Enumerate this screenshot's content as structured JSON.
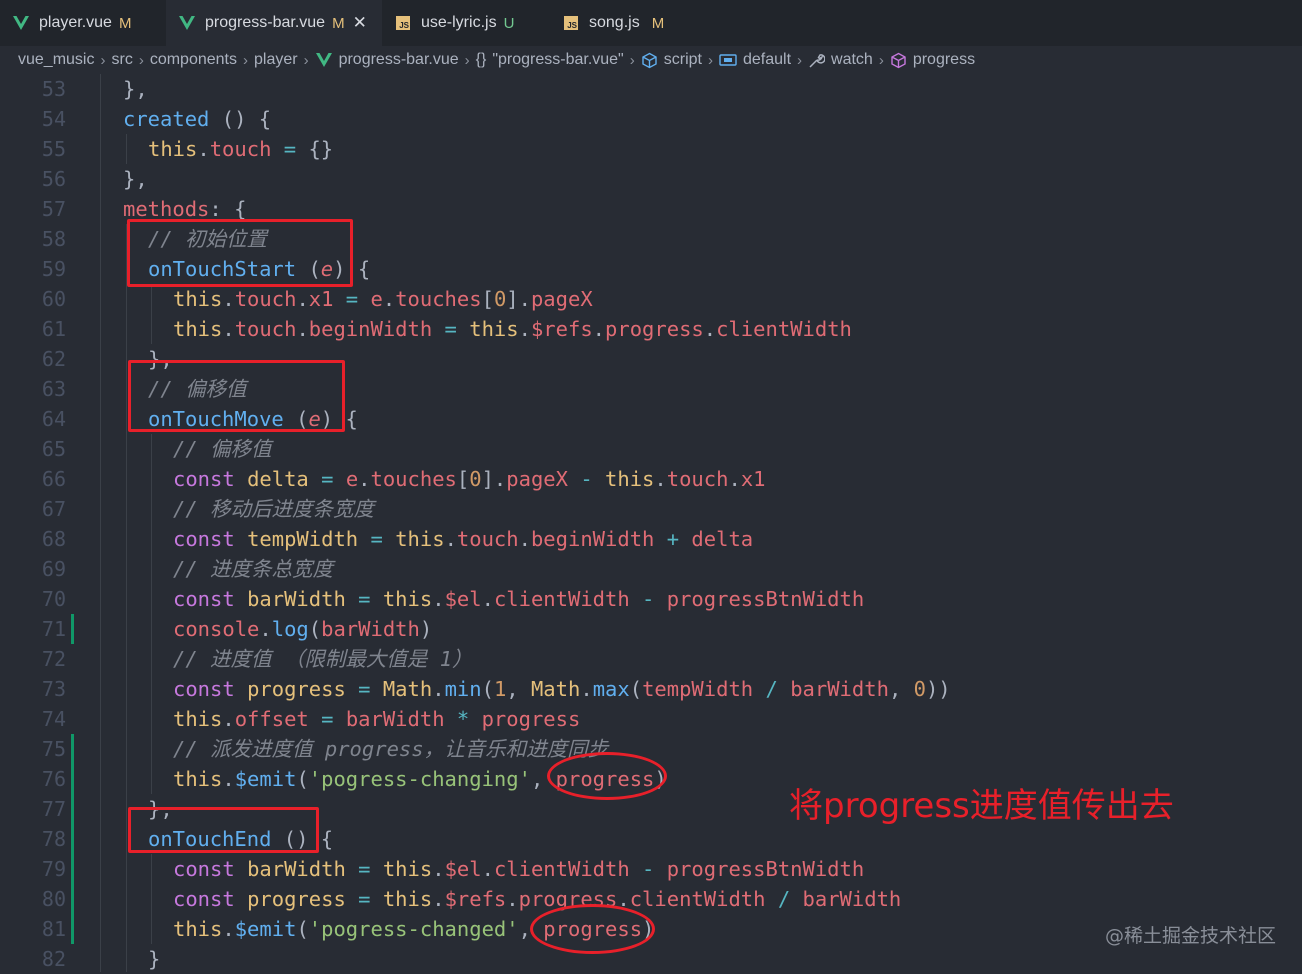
{
  "tabs": [
    {
      "label": "player.vue",
      "badge": "M",
      "icon": "vue-icon",
      "active": false
    },
    {
      "label": "progress-bar.vue",
      "badge": "M",
      "icon": "vue-icon",
      "active": true,
      "close": "✕"
    },
    {
      "label": "use-lyric.js",
      "badge": "U",
      "icon": "js-icon",
      "active": false
    },
    {
      "label": "song.js",
      "badge": "M",
      "icon": "js-icon",
      "active": false
    }
  ],
  "breadcrumb": [
    "vue_music",
    "src",
    "components",
    "player",
    "progress-bar.vue",
    "\"progress-bar.vue\"",
    "script",
    "default",
    "watch",
    "progress"
  ],
  "lines": [
    {
      "n": "53",
      "indent": 0,
      "t": [
        [
          "p",
          "},"
        ]
      ]
    },
    {
      "n": "54",
      "indent": 0,
      "t": [
        [
          "fn",
          "created"
        ],
        [
          "p",
          " () {"
        ]
      ]
    },
    {
      "n": "55",
      "indent": 1,
      "t": [
        [
          "thisk",
          "this"
        ],
        [
          "p",
          "."
        ],
        [
          "prop",
          "touch"
        ],
        [
          "op",
          " = "
        ],
        [
          "p",
          "{}"
        ]
      ]
    },
    {
      "n": "56",
      "indent": 0,
      "t": [
        [
          "p",
          "},"
        ]
      ]
    },
    {
      "n": "57",
      "indent": 0,
      "t": [
        [
          "prop",
          "methods"
        ],
        [
          "p",
          ": {"
        ]
      ]
    },
    {
      "n": "58",
      "indent": 1,
      "t": [
        [
          "cm",
          "// 初始位置"
        ]
      ]
    },
    {
      "n": "59",
      "indent": 1,
      "t": [
        [
          "fn",
          "onTouchStart"
        ],
        [
          "p",
          " ("
        ],
        [
          "param",
          "e"
        ],
        [
          "p",
          ") {"
        ]
      ]
    },
    {
      "n": "60",
      "indent": 2,
      "t": [
        [
          "thisk",
          "this"
        ],
        [
          "p",
          "."
        ],
        [
          "prop",
          "touch"
        ],
        [
          "p",
          "."
        ],
        [
          "prop",
          "x1"
        ],
        [
          "op",
          " = "
        ],
        [
          "varb",
          "e"
        ],
        [
          "p",
          "."
        ],
        [
          "prop",
          "touches"
        ],
        [
          "p",
          "["
        ],
        [
          "num",
          "0"
        ],
        [
          "p",
          "]."
        ],
        [
          "prop",
          "pageX"
        ]
      ]
    },
    {
      "n": "61",
      "indent": 2,
      "t": [
        [
          "thisk",
          "this"
        ],
        [
          "p",
          "."
        ],
        [
          "prop",
          "touch"
        ],
        [
          "p",
          "."
        ],
        [
          "prop",
          "beginWidth"
        ],
        [
          "op",
          " = "
        ],
        [
          "thisk",
          "this"
        ],
        [
          "p",
          "."
        ],
        [
          "prop",
          "$refs"
        ],
        [
          "p",
          "."
        ],
        [
          "prop",
          "progress"
        ],
        [
          "p",
          "."
        ],
        [
          "prop",
          "clientWidth"
        ]
      ]
    },
    {
      "n": "62",
      "indent": 1,
      "t": [
        [
          "p",
          "},"
        ]
      ]
    },
    {
      "n": "63",
      "indent": 1,
      "t": [
        [
          "cm",
          "// 偏移值"
        ]
      ]
    },
    {
      "n": "64",
      "indent": 1,
      "t": [
        [
          "fn",
          "onTouchMove"
        ],
        [
          "p",
          " ("
        ],
        [
          "param",
          "e"
        ],
        [
          "p",
          ") {"
        ]
      ]
    },
    {
      "n": "65",
      "indent": 2,
      "t": [
        [
          "cm",
          "// 偏移值"
        ]
      ]
    },
    {
      "n": "66",
      "indent": 2,
      "t": [
        [
          "kw",
          "const"
        ],
        [
          "p",
          " "
        ],
        [
          "cls",
          "delta"
        ],
        [
          "op",
          " = "
        ],
        [
          "varb",
          "e"
        ],
        [
          "p",
          "."
        ],
        [
          "prop",
          "touches"
        ],
        [
          "p",
          "["
        ],
        [
          "num",
          "0"
        ],
        [
          "p",
          "]."
        ],
        [
          "prop",
          "pageX"
        ],
        [
          "op",
          " - "
        ],
        [
          "thisk",
          "this"
        ],
        [
          "p",
          "."
        ],
        [
          "prop",
          "touch"
        ],
        [
          "p",
          "."
        ],
        [
          "prop",
          "x1"
        ]
      ]
    },
    {
      "n": "67",
      "indent": 2,
      "t": [
        [
          "cm",
          "// 移动后进度条宽度"
        ]
      ]
    },
    {
      "n": "68",
      "indent": 2,
      "t": [
        [
          "kw",
          "const"
        ],
        [
          "p",
          " "
        ],
        [
          "cls",
          "tempWidth"
        ],
        [
          "op",
          " = "
        ],
        [
          "thisk",
          "this"
        ],
        [
          "p",
          "."
        ],
        [
          "prop",
          "touch"
        ],
        [
          "p",
          "."
        ],
        [
          "prop",
          "beginWidth"
        ],
        [
          "op",
          " + "
        ],
        [
          "varb",
          "delta"
        ]
      ]
    },
    {
      "n": "69",
      "indent": 2,
      "t": [
        [
          "cm",
          "// 进度条总宽度"
        ]
      ]
    },
    {
      "n": "70",
      "indent": 2,
      "t": [
        [
          "kw",
          "const"
        ],
        [
          "p",
          " "
        ],
        [
          "cls",
          "barWidth"
        ],
        [
          "op",
          " = "
        ],
        [
          "thisk",
          "this"
        ],
        [
          "p",
          "."
        ],
        [
          "prop",
          "$el"
        ],
        [
          "p",
          "."
        ],
        [
          "prop",
          "clientWidth"
        ],
        [
          "op",
          " - "
        ],
        [
          "varb",
          "progressBtnWidth"
        ]
      ]
    },
    {
      "n": "71",
      "indent": 2,
      "t": [
        [
          "prop",
          "console"
        ],
        [
          "p",
          "."
        ],
        [
          "fn",
          "log"
        ],
        [
          "p",
          "("
        ],
        [
          "varb",
          "barWidth"
        ],
        [
          "p",
          ")"
        ]
      ]
    },
    {
      "n": "72",
      "indent": 2,
      "t": [
        [
          "cm",
          "// 进度值 （限制最大值是 1）"
        ]
      ]
    },
    {
      "n": "73",
      "indent": 2,
      "t": [
        [
          "kw",
          "const"
        ],
        [
          "p",
          " "
        ],
        [
          "cls",
          "progress"
        ],
        [
          "op",
          " = "
        ],
        [
          "cls",
          "Math"
        ],
        [
          "p",
          "."
        ],
        [
          "fn",
          "min"
        ],
        [
          "p",
          "("
        ],
        [
          "num",
          "1"
        ],
        [
          "p",
          ", "
        ],
        [
          "cls",
          "Math"
        ],
        [
          "p",
          "."
        ],
        [
          "fn",
          "max"
        ],
        [
          "p",
          "("
        ],
        [
          "varb",
          "tempWidth"
        ],
        [
          "op",
          " / "
        ],
        [
          "varb",
          "barWidth"
        ],
        [
          "p",
          ", "
        ],
        [
          "num",
          "0"
        ],
        [
          "p",
          "))"
        ]
      ]
    },
    {
      "n": "74",
      "indent": 2,
      "t": [
        [
          "thisk",
          "this"
        ],
        [
          "p",
          "."
        ],
        [
          "prop",
          "offset"
        ],
        [
          "op",
          " = "
        ],
        [
          "varb",
          "barWidth"
        ],
        [
          "op",
          " * "
        ],
        [
          "varb",
          "progress"
        ]
      ]
    },
    {
      "n": "75",
      "indent": 2,
      "t": [
        [
          "cm",
          "// 派发进度值 progress，让音乐和进度同步"
        ]
      ]
    },
    {
      "n": "76",
      "indent": 2,
      "t": [
        [
          "thisk",
          "this"
        ],
        [
          "p",
          "."
        ],
        [
          "fn",
          "$emit"
        ],
        [
          "p",
          "("
        ],
        [
          "str",
          "'pogress-changing'"
        ],
        [
          "p",
          ", "
        ],
        [
          "varb",
          "progress"
        ],
        [
          "p",
          ")"
        ]
      ]
    },
    {
      "n": "77",
      "indent": 1,
      "t": [
        [
          "p",
          "},"
        ]
      ]
    },
    {
      "n": "78",
      "indent": 1,
      "t": [
        [
          "fn",
          "onTouchEnd"
        ],
        [
          "p",
          " () {"
        ]
      ]
    },
    {
      "n": "79",
      "indent": 2,
      "t": [
        [
          "kw",
          "const"
        ],
        [
          "p",
          " "
        ],
        [
          "cls",
          "barWidth"
        ],
        [
          "op",
          " = "
        ],
        [
          "thisk",
          "this"
        ],
        [
          "p",
          "."
        ],
        [
          "prop",
          "$el"
        ],
        [
          "p",
          "."
        ],
        [
          "prop",
          "clientWidth"
        ],
        [
          "op",
          " - "
        ],
        [
          "varb",
          "progressBtnWidth"
        ]
      ]
    },
    {
      "n": "80",
      "indent": 2,
      "t": [
        [
          "kw",
          "const"
        ],
        [
          "p",
          " "
        ],
        [
          "cls",
          "progress"
        ],
        [
          "op",
          " = "
        ],
        [
          "thisk",
          "this"
        ],
        [
          "p",
          "."
        ],
        [
          "prop",
          "$refs"
        ],
        [
          "p",
          "."
        ],
        [
          "prop",
          "progress"
        ],
        [
          "p",
          "."
        ],
        [
          "prop",
          "clientWidth"
        ],
        [
          "op",
          " / "
        ],
        [
          "varb",
          "barWidth"
        ]
      ]
    },
    {
      "n": "81",
      "indent": 2,
      "t": [
        [
          "thisk",
          "this"
        ],
        [
          "p",
          "."
        ],
        [
          "fn",
          "$emit"
        ],
        [
          "p",
          "("
        ],
        [
          "str",
          "'pogress-changed'"
        ],
        [
          "p",
          ", "
        ],
        [
          "varb",
          "progress"
        ],
        [
          "p",
          ")"
        ]
      ]
    },
    {
      "n": "82",
      "indent": 1,
      "t": [
        [
          "p",
          "}"
        ]
      ]
    }
  ],
  "annotation": "将progress进度值传出去",
  "watermark": "@稀土掘金技术社区",
  "colors": {
    "annotation": "#e8202a",
    "background": "#282c34",
    "tabbar": "#21252b",
    "gutter_change": "#109868"
  }
}
